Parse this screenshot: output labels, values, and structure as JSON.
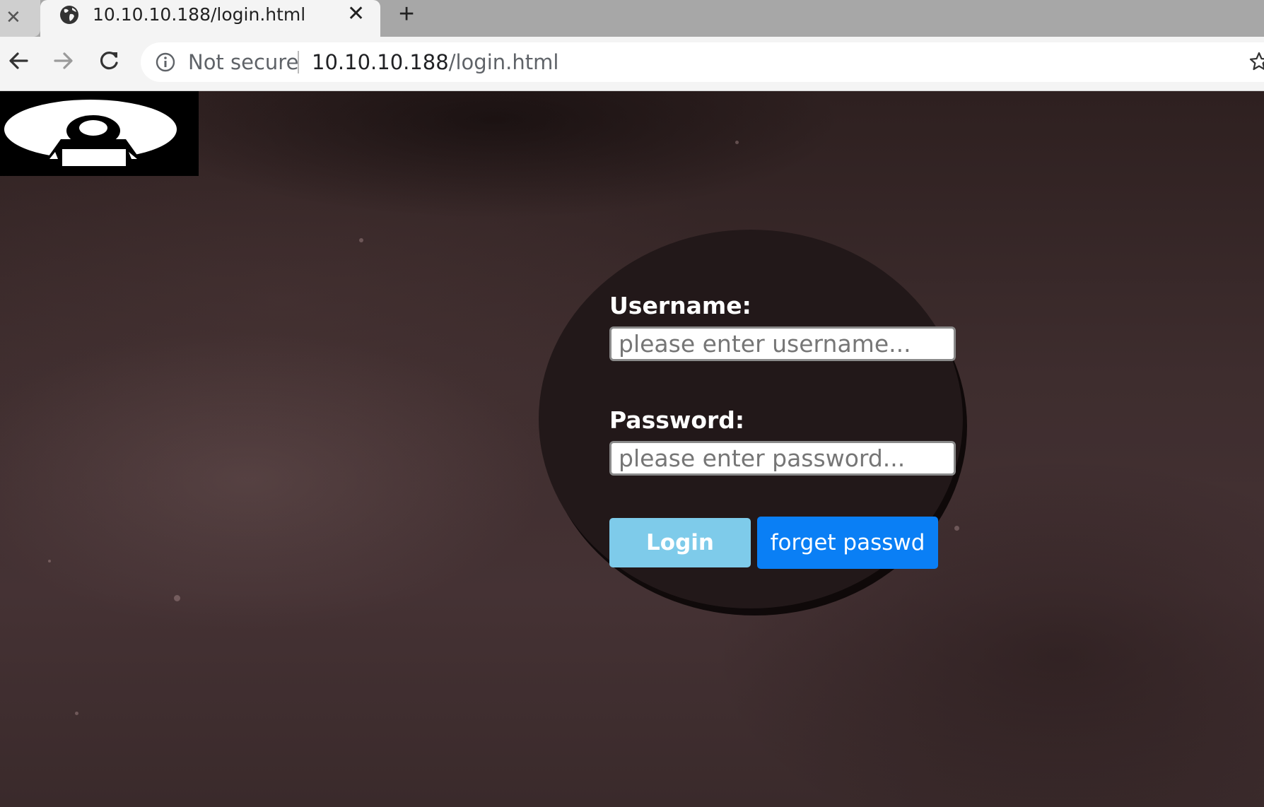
{
  "browser": {
    "tabs": [
      {
        "title": "",
        "state": "inactive"
      },
      {
        "title": "10.10.10.188/login.html",
        "state": "active"
      }
    ],
    "address_bar": {
      "security_label": "Not secure",
      "host": "10.10.10.188",
      "path": "/login.html"
    }
  },
  "login_form": {
    "username_label": "Username:",
    "username_placeholder": "please enter username...",
    "password_label": "Password:",
    "password_placeholder": "please enter password...",
    "login_button": "Login",
    "forget_button": "forget passwd"
  },
  "colors": {
    "login_button": "#7ecbea",
    "forget_button": "#0a7ff5",
    "background": "#3b2b2c",
    "circle": "#221819"
  }
}
